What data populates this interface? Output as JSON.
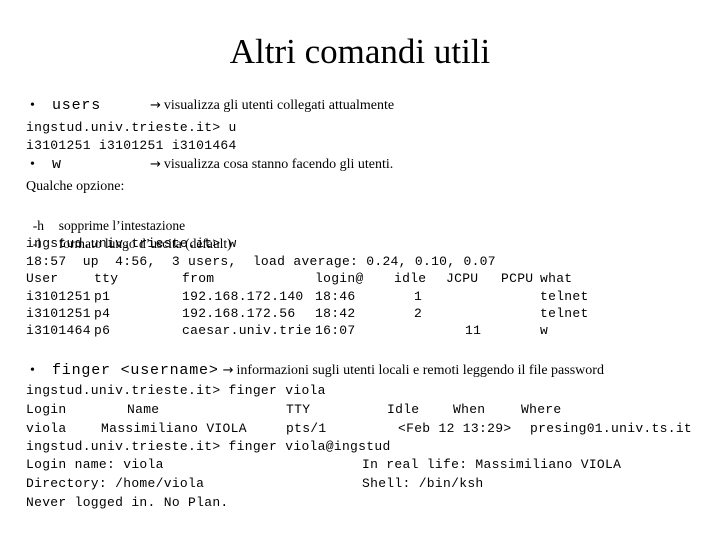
{
  "title": "Altri comandi utili",
  "sections": {
    "users": {
      "bullet": "•",
      "command": "users",
      "arrow_icon": "→",
      "description": "visualizza gli utenti collegati attualmente",
      "output": [
        "ingstud.univ.trieste.it> u",
        "i3101251 i3101251 i3101464"
      ]
    },
    "w": {
      "bullet": "•",
      "command": "w",
      "arrow_icon": "→",
      "description": "visualizza cosa stanno facendo gli utenti.",
      "options_heading": "Qualche opzione:",
      "options": [
        {
          "flag": "-h",
          "text": "sopprime l’intestazione"
        },
        {
          "flag": "-l",
          "text": "formato lungo d’uscita (default)"
        }
      ],
      "prompt": "ingstud.univ.trieste.it> w",
      "uptime_line": "18:57  up  4:56,  3 users,  load average: 0.24, 0.10, 0.07",
      "table": {
        "headers": [
          "User",
          "tty",
          "from",
          "login@",
          "idle",
          "JCPU",
          "PCPU",
          "what"
        ],
        "rows": [
          [
            "i3101251",
            "p1",
            "192.168.172.140",
            "18:46",
            "1",
            "",
            "",
            "telnet"
          ],
          [
            "i3101251",
            "p4",
            "192.168.172.56",
            "18:42",
            "2",
            "",
            "",
            "telnet"
          ],
          [
            "i3101464",
            "p6",
            "caesar.univ.trie",
            "16:07",
            "",
            "11",
            "",
            "w"
          ]
        ]
      }
    },
    "finger": {
      "bullet": "•",
      "command": "finger <username>",
      "arrow_icon": "→",
      "description": "informazioni sugli utenti locali e remoti leggendo il file password",
      "prompt1": "ingstud.univ.trieste.it> finger viola",
      "table": {
        "headers": [
          "Login",
          "Name",
          "TTY",
          "Idle",
          "When",
          "Where"
        ],
        "row": [
          "viola",
          "Massimiliano VIOLA",
          "pts/1",
          "",
          "<Feb 12 13:29>",
          "presing01.univ.ts.it"
        ]
      },
      "prompt2": "ingstud.univ.trieste.it> finger viola@ingstud",
      "details": [
        {
          "left": "Login name: viola",
          "right": "In real life: Massimiliano VIOLA"
        },
        {
          "left": "Directory: /home/viola",
          "right": "Shell: /bin/ksh"
        },
        {
          "left": "Never logged in. No Plan.",
          "right": ""
        }
      ]
    }
  }
}
